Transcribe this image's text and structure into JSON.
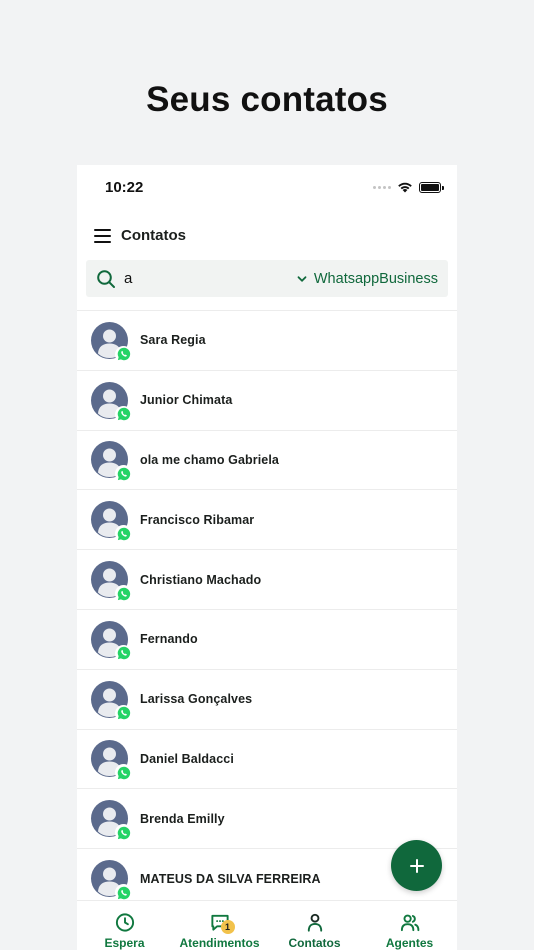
{
  "promo": {
    "title": "Seus contatos"
  },
  "status_bar": {
    "time": "10:22"
  },
  "header": {
    "title": "Contatos"
  },
  "search": {
    "value": "a",
    "placeholder": ""
  },
  "channel_filter": {
    "selected": "WhatsappBusiness"
  },
  "contacts": [
    {
      "name": "Sara Regia",
      "channel": "whatsapp"
    },
    {
      "name": "Junior Chimata",
      "channel": "whatsapp"
    },
    {
      "name": "ola me chamo Gabriela",
      "channel": "whatsapp"
    },
    {
      "name": "Francisco Ribamar",
      "channel": "whatsapp"
    },
    {
      "name": "Christiano Machado",
      "channel": "whatsapp"
    },
    {
      "name": "Fernando",
      "channel": "whatsapp"
    },
    {
      "name": "Larissa Gonçalves",
      "channel": "whatsapp"
    },
    {
      "name": "Daniel Baldacci",
      "channel": "whatsapp"
    },
    {
      "name": "Brenda Emilly",
      "channel": "whatsapp"
    },
    {
      "name": "MATEUS DA SILVA FERREIRA",
      "channel": "whatsapp"
    }
  ],
  "fab": {
    "icon": "plus-icon"
  },
  "bottom_nav": [
    {
      "label": "Espera",
      "icon": "clock-icon"
    },
    {
      "label": "Atendimentos",
      "icon": "chat-icon",
      "badge": "1"
    },
    {
      "label": "Contatos",
      "icon": "person-icon",
      "active": true
    },
    {
      "label": "Agentes",
      "icon": "people-icon"
    }
  ],
  "colors": {
    "brand_green": "#10683c",
    "whatsapp_green": "#25d366",
    "avatar_blue": "#5b6a8c",
    "badge_yellow": "#f2c24b"
  }
}
